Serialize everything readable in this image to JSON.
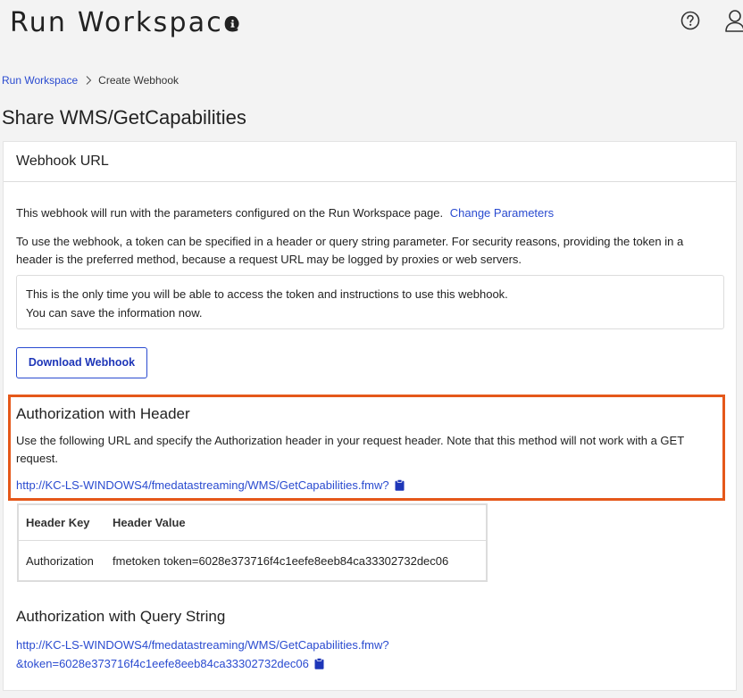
{
  "header": {
    "app_title": "Run Workspace",
    "icons": [
      "info-icon",
      "help-icon",
      "user-icon"
    ]
  },
  "breadcrumb": {
    "parent": "Run Workspace",
    "current": "Create Webhook"
  },
  "page_title": "Share WMS/GetCapabilities",
  "card": {
    "title": "Webhook URL",
    "intro_text": "This webhook will run with the parameters configured on the Run Workspace page.",
    "change_parameters_link": "Change Parameters",
    "token_info": "To use the webhook, a token can be specified in a header or query string parameter. For security reasons, providing the token in a header is the preferred method, because a request URL may be logged by proxies or web servers.",
    "notice_line1": "This is the only time you will be able to access the token and instructions to use this webhook.",
    "notice_line2": "You can save the information now.",
    "download_button": "Download Webhook"
  },
  "auth_header": {
    "title": "Authorization with Header",
    "description": "Use the following URL and specify the Authorization header in your request header. Note that this method will not work with a GET request.",
    "url": "http://KC-LS-WINDOWS4/fmedatastreaming/WMS/GetCapabilities.fmw?",
    "table": {
      "columns": [
        "Header Key",
        "Header Value"
      ],
      "rows": [
        [
          "Authorization",
          "fmetoken token=6028e373716f4c1eefe8eeb84ca33302732dec06"
        ]
      ]
    }
  },
  "auth_query": {
    "title": "Authorization with Query String",
    "url_line1": "http://KC-LS-WINDOWS4/fmedatastreaming/WMS/GetCapabilities.fmw?",
    "url_line2": "&token=6028e373716f4c1eefe8eeb84ca33302732dec06"
  },
  "colors": {
    "link": "#2a4bd0",
    "highlight": "#e5581a",
    "background": "#f3f3f3"
  }
}
